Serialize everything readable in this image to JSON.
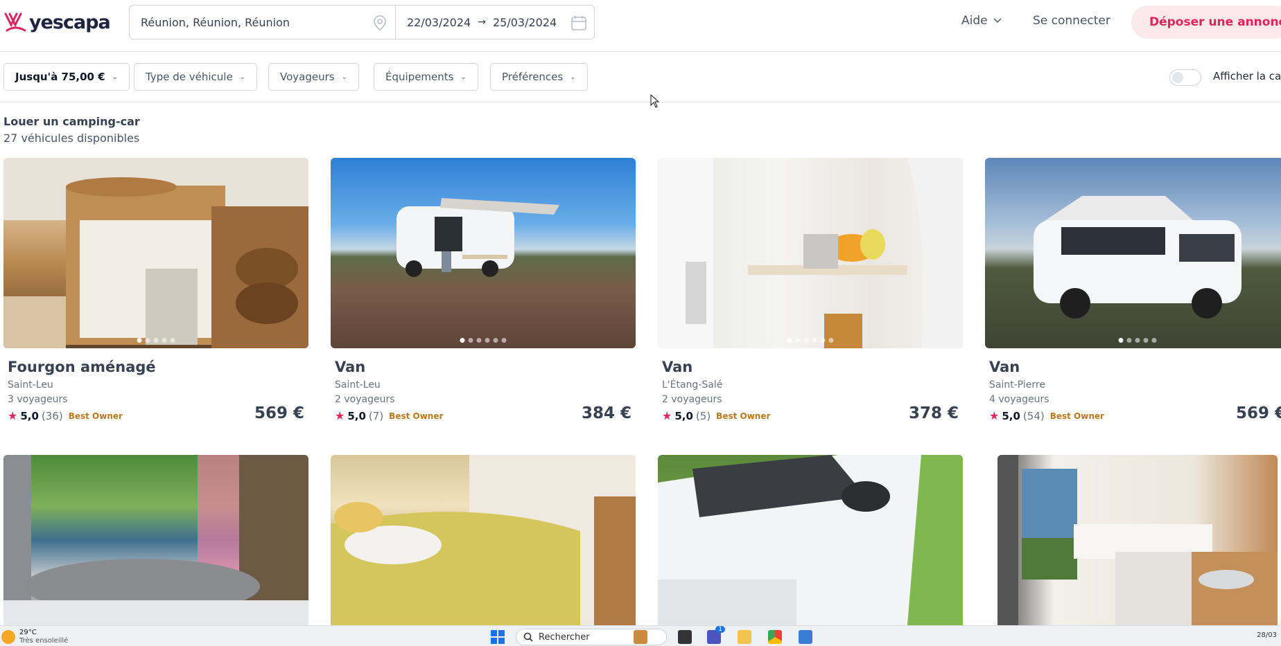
{
  "header": {
    "logo_text": "yescapa",
    "search_location": "Réunion, Réunion, Réunion",
    "date_start": "22/03/2024",
    "date_arrow": "→",
    "date_end": "25/03/2024",
    "help_label": "Aide",
    "login_label": "Se connecter",
    "cta_label": "Déposer une annonce",
    "brand_color": "#e0245e"
  },
  "filters": {
    "price": "Jusqu'à 75,00 €",
    "vehicle_type": "Type de véhicule",
    "travelers": "Voyageurs",
    "equipment": "Équipements",
    "preferences": "Préférences",
    "map_toggle_label": "Afficher la carte",
    "map_toggle_on": false
  },
  "results": {
    "title": "Louer un camping-car",
    "count": "27 véhicules disponibles"
  },
  "listings": [
    {
      "title": "Fourgon aménagé",
      "place": "Saint-Leu",
      "guests": "3 voyageurs",
      "score": "5,0",
      "reviews": "(36)",
      "badge": "Best Owner",
      "price": "569 €",
      "photo_dots": 5
    },
    {
      "title": "Van",
      "place": "Saint-Leu",
      "guests": "2 voyageurs",
      "score": "5,0",
      "reviews": "(7)",
      "badge": "Best Owner",
      "price": "384 €",
      "photo_dots": 6
    },
    {
      "title": "Van",
      "place": "L'Étang-Salé",
      "guests": "2 voyageurs",
      "score": "5,0",
      "reviews": "(5)",
      "badge": "Best Owner",
      "price": "378 €",
      "photo_dots": 6
    },
    {
      "title": "Van",
      "place": "Saint-Pierre",
      "guests": "4 voyageurs",
      "score": "5,0",
      "reviews": "(54)",
      "badge": "Best Owner",
      "price": "569 €",
      "photo_dots": 5
    },
    {
      "title": "",
      "place": "",
      "guests": "",
      "score": "",
      "reviews": "",
      "badge": "",
      "price": "",
      "photo_dots": 0
    },
    {
      "title": "",
      "place": "",
      "guests": "",
      "score": "",
      "reviews": "",
      "badge": "",
      "price": "",
      "photo_dots": 0
    },
    {
      "title": "",
      "place": "",
      "guests": "",
      "score": "",
      "reviews": "",
      "badge": "",
      "price": "",
      "photo_dots": 0
    },
    {
      "title": "",
      "place": "",
      "guests": "",
      "score": "",
      "reviews": "",
      "badge": "",
      "price": "",
      "photo_dots": 0
    }
  ],
  "taskbar": {
    "temperature": "29°C",
    "condition": "Très ensoleillé",
    "search_label": "Rechercher",
    "teams_badge": "1",
    "date": "28/03"
  }
}
